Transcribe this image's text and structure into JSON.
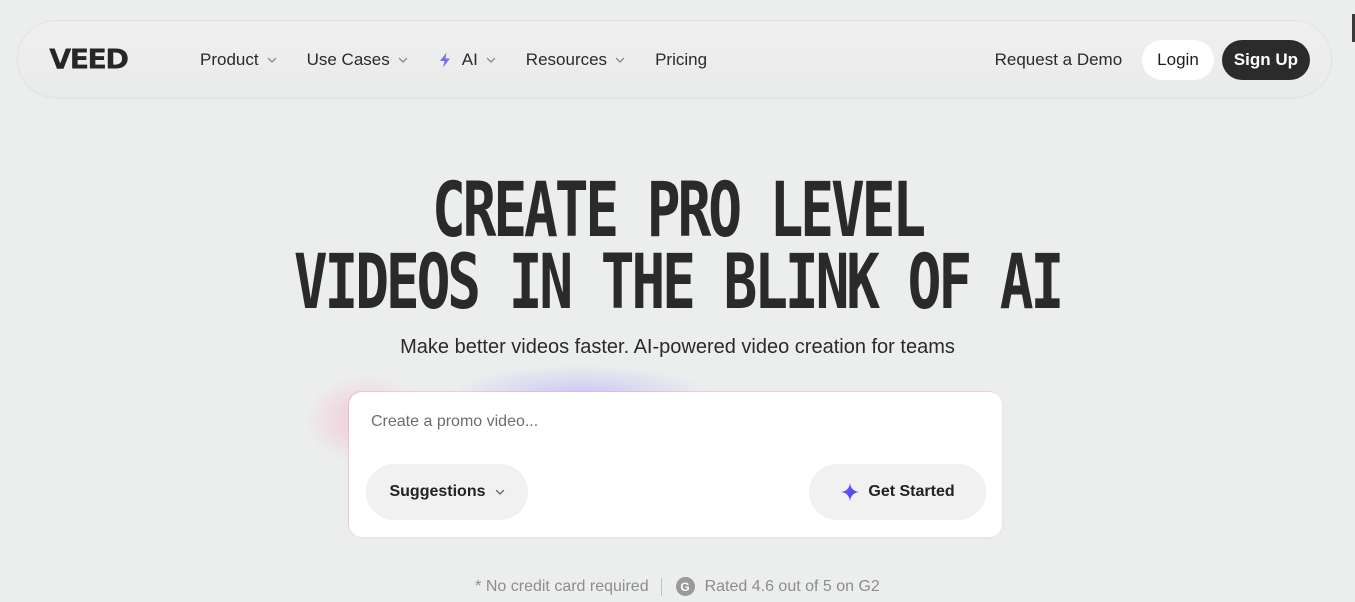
{
  "brand": {
    "logo": "VEED",
    "accent_color": "#6b5cf6"
  },
  "nav": {
    "links": [
      {
        "label": "Product",
        "icon": "chevron-down-icon"
      },
      {
        "label": "Use Cases",
        "icon": "chevron-down-icon"
      },
      {
        "label": "AI",
        "icon": "chevron-down-icon",
        "leading_icon": "sparkle-icon"
      },
      {
        "label": "Resources",
        "icon": "chevron-down-icon"
      },
      {
        "label": "Pricing"
      }
    ],
    "request_demo": "Request a Demo",
    "login": "Login",
    "signup": "Sign Up"
  },
  "hero": {
    "title_line1": "CREATE PRO LEVEL",
    "title_line2": "VIDEOS IN THE BLINK OF AI",
    "subtitle": "Make better videos faster. AI-powered video creation for teams"
  },
  "prompt": {
    "placeholder": "Create a promo video...",
    "value": "",
    "suggestions_label": "Suggestions",
    "get_started_label": "Get Started"
  },
  "footnote": {
    "no_card": "* No credit card required",
    "g2_icon_glyph": "G",
    "rating": "Rated 4.6 out of 5 on G2"
  }
}
